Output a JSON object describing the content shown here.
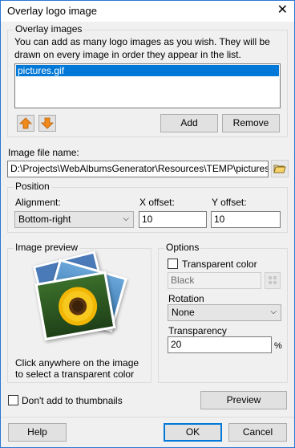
{
  "window": {
    "title": "Overlay logo image",
    "close_glyph": "✕"
  },
  "overlay_images": {
    "legend": "Overlay images",
    "description": "You can add as many logo images as you wish. They will be drawn on every image in order they appear in the list.",
    "items": [
      "pictures.gif"
    ],
    "add_label": "Add",
    "remove_label": "Remove",
    "move_up_icon": "arrow-up-icon",
    "move_down_icon": "arrow-down-icon"
  },
  "image_file": {
    "label": "Image file name:",
    "value": "D:\\Projects\\WebAlbumsGenerator\\Resources\\TEMP\\pictures.gif",
    "browse_icon": "folder-open-icon"
  },
  "position": {
    "legend": "Position",
    "alignment_label": "Alignment:",
    "alignment_value": "Bottom-right",
    "x_offset_label": "X offset:",
    "x_offset_value": "10",
    "y_offset_label": "Y offset:",
    "y_offset_value": "10"
  },
  "image_preview": {
    "legend": "Image preview",
    "hint": "Click anywhere on the image to select a transparent color"
  },
  "options": {
    "legend": "Options",
    "transparent_color_label": "Transparent color",
    "transparent_color_value": "Black",
    "rotation_label": "Rotation",
    "rotation_value": "None",
    "transparency_label": "Transparency",
    "transparency_value": "20",
    "transparency_unit": "%"
  },
  "bottom": {
    "dont_add_thumbnails_label": "Don't add to thumbnails",
    "preview_label": "Preview",
    "help_label": "Help",
    "ok_label": "OK",
    "cancel_label": "Cancel"
  },
  "colors": {
    "selection": "#0078d7",
    "arrow_orange": "#f08a1c",
    "window_bg": "#f0f0f0"
  }
}
